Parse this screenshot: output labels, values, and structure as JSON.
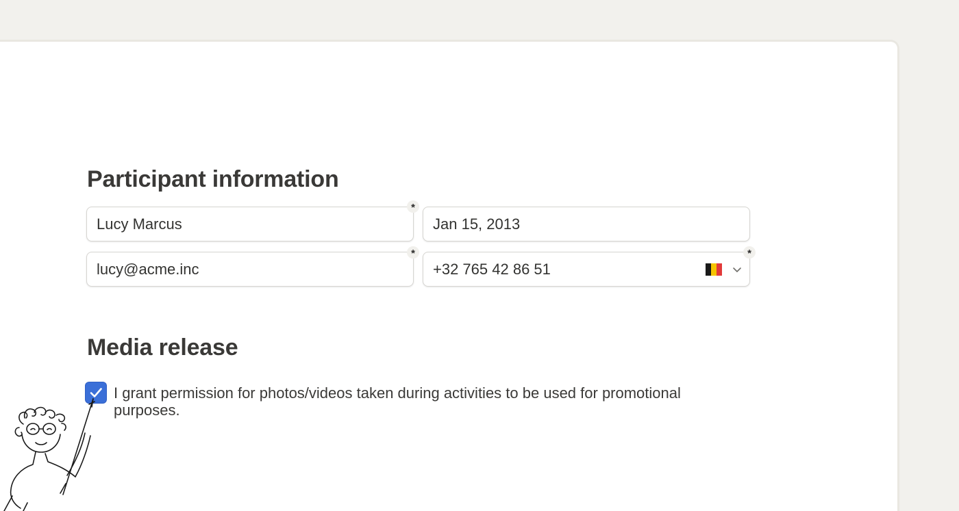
{
  "sections": {
    "participant": {
      "title": "Participant information",
      "name_value": "Lucy Marcus",
      "dob_value": "Jan 15, 2013",
      "email_value": "lucy@acme.inc",
      "phone_value": "+32 765 42 86 51",
      "required_marker": "*",
      "phone_country_flag": "belgium-flag-icon",
      "flag_colors": [
        "#1a1a1a",
        "#f5c400",
        "#e23a3a"
      ]
    },
    "media": {
      "title": "Media release",
      "consent_checked": true,
      "consent_text": "I grant permission for photos/videos taken during activities to be used for promotional purposes."
    }
  },
  "colors": {
    "accent": "#3a6fd8",
    "background": "#f2f1ed"
  }
}
